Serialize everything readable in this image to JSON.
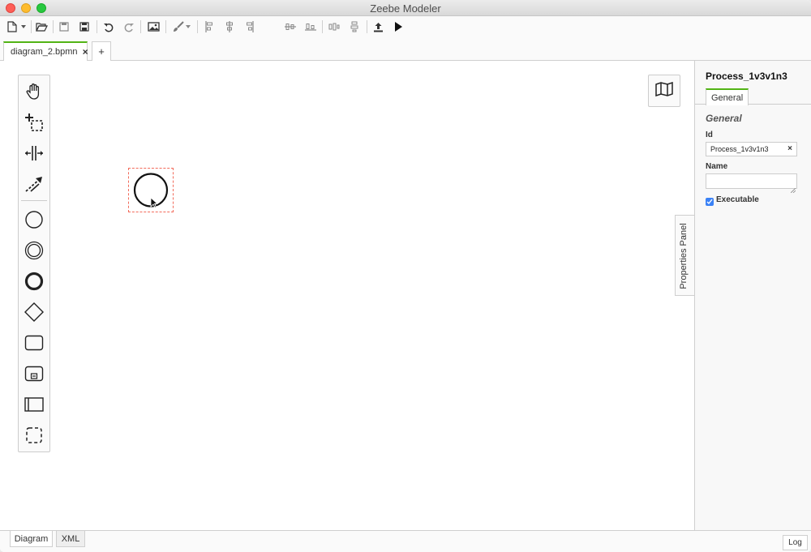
{
  "window": {
    "title": "Zeebe Modeler"
  },
  "toolbar": {
    "items": [
      "new-file-icon",
      "dropdown-arrow-icon",
      "open-folder-icon",
      "save-icon",
      "save-as-icon",
      "undo-icon",
      "redo-icon",
      "export-image-icon",
      "color-brush-icon",
      "align-left-icon",
      "align-center-icon",
      "align-right-icon",
      "align-top-icon",
      "align-middle-icon",
      "align-bottom-icon",
      "distribute-horizontal-icon",
      "distribute-vertical-icon",
      "deploy-icon",
      "start-instance-icon"
    ]
  },
  "tabs": {
    "file_tab": "diagram_2.bpmn",
    "close_glyph": "×",
    "add_glyph": "+"
  },
  "palette": {
    "tools": [
      "hand-tool-icon",
      "lasso-tool-icon",
      "space-tool-icon",
      "global-connect-icon",
      "start-event-icon",
      "intermediate-event-icon",
      "end-event-icon",
      "gateway-icon",
      "task-icon",
      "subprocess-icon",
      "pool-icon",
      "group-icon"
    ]
  },
  "properties": {
    "process_id": "Process_1v3v1n3",
    "tab_general": "General",
    "group_general": "General",
    "id_label": "Id",
    "id_value": "Process_1v3v1n3",
    "clear_glyph": "×",
    "name_label": "Name",
    "name_value": "",
    "executable_label": "Executable",
    "executable_checked": true,
    "toggle_label": "Properties Panel"
  },
  "bottom": {
    "diagram_tab": "Diagram",
    "xml_tab": "XML",
    "log_button": "Log"
  },
  "colors": {
    "accent_green": "#52b415",
    "selection_outline": "#f26b5b",
    "checkbox_blue": "#3b82f6"
  }
}
